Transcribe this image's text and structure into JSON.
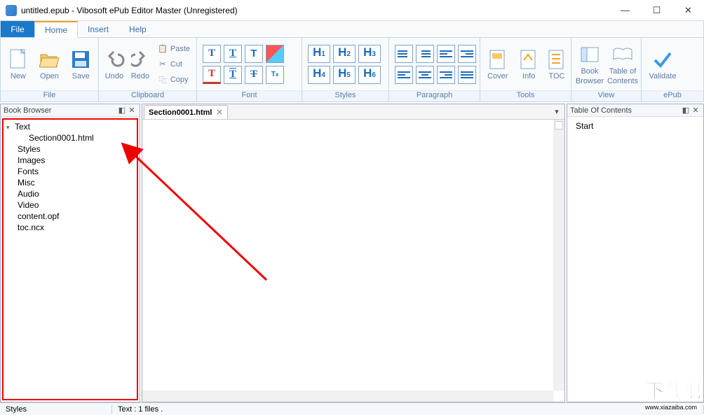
{
  "window": {
    "title": "untitled.epub - Vibosoft ePub Editor Master (Unregistered)"
  },
  "menu": {
    "file": "File",
    "tabs": [
      "Home",
      "Insert",
      "Help"
    ],
    "active": "Home"
  },
  "ribbon": {
    "file_grp": {
      "label": "File",
      "new": "New",
      "open": "Open",
      "save": "Save"
    },
    "clipboard": {
      "label": "Clipboard",
      "undo": "Undo",
      "redo": "Redo",
      "paste": "Paste",
      "cut": "Cut",
      "copy": "Copy"
    },
    "font": {
      "label": "Font"
    },
    "styles": {
      "label": "Styles"
    },
    "paragraph": {
      "label": "Paragraph"
    },
    "tools": {
      "label": "Tools",
      "cover": "Cover",
      "info": "Info",
      "toc": "TOC"
    },
    "view": {
      "label": "View",
      "book_browser1": "Book",
      "book_browser2": "Browser",
      "toc1": "Table of",
      "toc2": "Contents"
    },
    "epub": {
      "label": "ePub",
      "validate": "Validate"
    }
  },
  "panels": {
    "book_browser": "Book Browser",
    "toc": "Table Of Contents"
  },
  "tree": {
    "root": "Text",
    "section": "Section0001.html",
    "folders": [
      "Styles",
      "Images",
      "Fonts",
      "Misc",
      "Audio",
      "Video",
      "content.opf",
      "toc.ncx"
    ],
    "selected": "Styles"
  },
  "editor": {
    "tab": "Section0001.html"
  },
  "toc": {
    "start": "Start"
  },
  "status": {
    "left": "Styles",
    "right": "Text : 1 files ."
  },
  "watermark": {
    "big": "下载吧",
    "small": "www.xiazaiba.com"
  }
}
